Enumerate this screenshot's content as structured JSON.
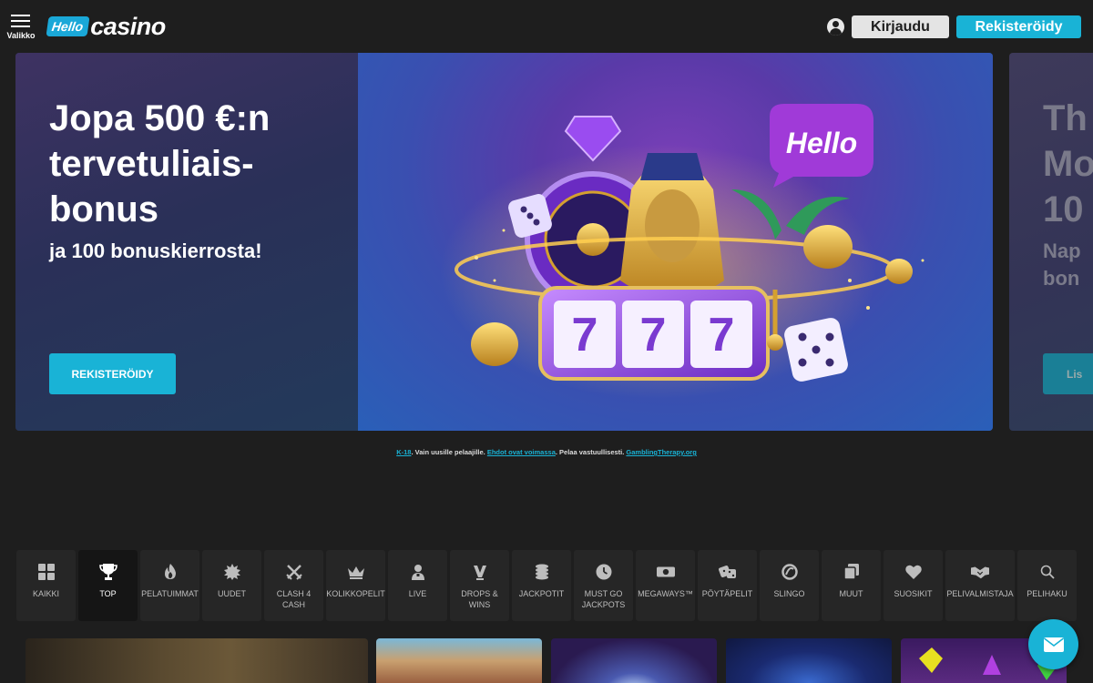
{
  "header": {
    "menu_label": "Valikko",
    "logo_hello": "Hello",
    "logo_casino": "casino",
    "login_label": "Kirjaudu",
    "register_label": "Rekisteröidy"
  },
  "hero": {
    "title": "Jopa 500 €:n tervetuliais-bonus",
    "subtitle": "ja 100 bonuskierrosta!",
    "cta_label": "REKISTERÖIDY",
    "art_bubble_text": "Hello"
  },
  "next_card": {
    "title_lines": [
      "Th",
      "Mo",
      "10"
    ],
    "title_line_1": "Th",
    "title_line_2": "Mo",
    "title_line_3": "10",
    "sub_line_1": "Nap",
    "sub_line_2": "bon",
    "cta_label": "Lis"
  },
  "disclaimer": {
    "age": "K-18",
    "text1": ". Vain uusille pelaajille. ",
    "terms": "Ehdot ovat voimassa",
    "text2": ". Pelaa vastuullisesti. ",
    "therapy": "GamblingTherapy.org"
  },
  "categories": [
    {
      "label": "KAIKKI",
      "icon": "grid-icon"
    },
    {
      "label": "TOP",
      "icon": "trophy-icon"
    },
    {
      "label": "PELATUIMMAT",
      "icon": "flame-icon"
    },
    {
      "label": "UUDET",
      "icon": "starburst-icon"
    },
    {
      "label": "CLASH 4 CASH",
      "icon": "crossed-swords-icon"
    },
    {
      "label": "KOLIKKOPELIT",
      "icon": "crown-icon"
    },
    {
      "label": "LIVE",
      "icon": "dealer-icon"
    },
    {
      "label": "DROPS & WINS",
      "icon": "drops-icon"
    },
    {
      "label": "JACKPOTIT",
      "icon": "coins-icon"
    },
    {
      "label": "MUST GO JACKPOTS",
      "icon": "clock-icon"
    },
    {
      "label": "MEGAWAYS™",
      "icon": "megaways-icon"
    },
    {
      "label": "PÖYTÄPELIT",
      "icon": "dice-icon"
    },
    {
      "label": "SLINGO",
      "icon": "slingo-icon"
    },
    {
      "label": "MUUT",
      "icon": "cards-icon"
    },
    {
      "label": "SUOSIKIT",
      "icon": "heart-icon"
    },
    {
      "label": "PELIVALMISTAJA",
      "icon": "handshake-icon"
    },
    {
      "label": "PELIHAKU",
      "icon": "search-icon"
    }
  ],
  "colors": {
    "accent": "#19b3d6",
    "background": "#1e1e1e",
    "tile": "#262626"
  }
}
